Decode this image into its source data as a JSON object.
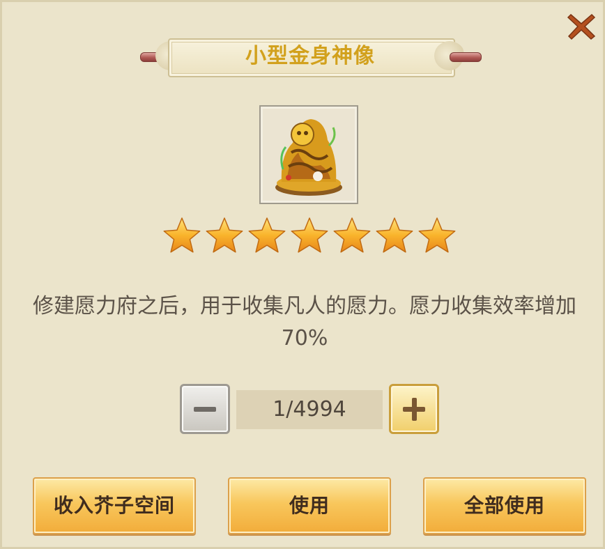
{
  "title": "小型金身神像",
  "item": {
    "icon": "golden-statue-icon",
    "stars": 7
  },
  "description": "修建愿力府之后，用于收集凡人的愿力。愿力收集效率增加70%",
  "quantity": {
    "display": "1/4994"
  },
  "buttons": {
    "store_label": "收入芥子空间",
    "use_label": "使用",
    "use_all_label": "全部使用"
  },
  "colors": {
    "title": "#d2a11d",
    "button": "#f8c75c",
    "panel_bg": "#ebe4cb"
  }
}
